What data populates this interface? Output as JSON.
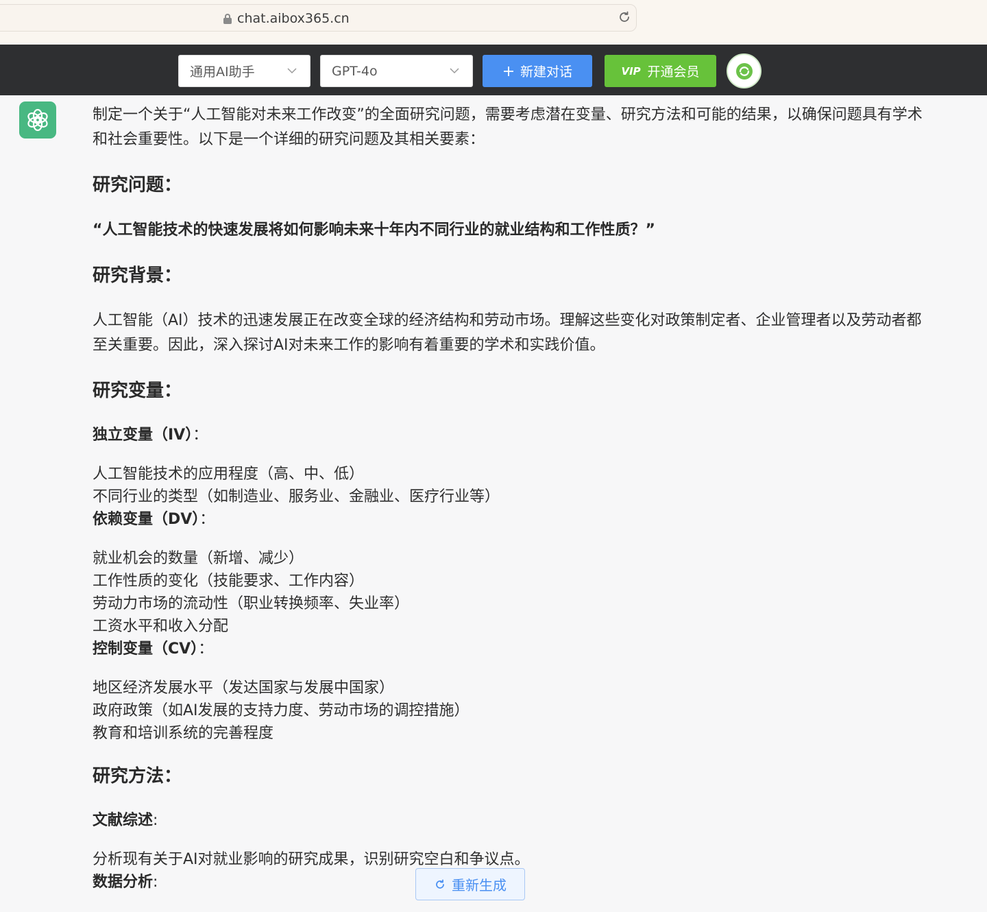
{
  "browser": {
    "url": "chat.aibox365.cn"
  },
  "toolbar": {
    "assistant_select": "通用AI助手",
    "model_select": "GPT-4o",
    "new_chat_label": "新建对话",
    "vip_label": "开通会员",
    "vip_badge_text": "VIP"
  },
  "message": {
    "intro": "制定一个关于“人工智能对未来工作改变”的全面研究问题，需要考虑潜在变量、研究方法和可能的结果，以确保问题具有学术和社会重要性。以下是一个详细的研究问题及其相关要素：",
    "question_heading": "研究问题：",
    "question_text": "“人工智能技术的快速发展将如何影响未来十年内不同行业的就业结构和工作性质？”",
    "background_heading": "研究背景：",
    "background_text": "人工智能（AI）技术的迅速发展正在改变全球的经济结构和劳动市场。理解这些变化对政策制定者、企业管理者以及劳动者都至关重要。因此，深入探讨AI对未来工作的影响有着重要的学术和实践价值。",
    "variables_heading": "研究变量：",
    "iv_label": "独立变量（IV）",
    "iv_items": [
      "人工智能技术的应用程度（高、中、低）",
      "不同行业的类型（如制造业、服务业、金融业、医疗行业等）"
    ],
    "dv_label": "依赖变量（DV）",
    "dv_items": [
      "就业机会的数量（新增、减少）",
      "工作性质的变化（技能要求、工作内容）",
      "劳动力市场的流动性（职业转换频率、失业率）",
      "工资水平和收入分配"
    ],
    "cv_label": "控制变量（CV）",
    "cv_items": [
      "地区经济发展水平（发达国家与发展中国家）",
      "政府政策（如AI发展的支持力度、劳动市场的调控措施）",
      "教育和培训系统的完善程度"
    ],
    "methods_heading": "研究方法：",
    "lit_label": "文献综述",
    "lit_text": "分析现有关于AI对就业影响的研究成果，识别研究空白和争议点。",
    "data_label": "数据分析",
    "colon": "：",
    "colon_short": ":"
  },
  "regen": {
    "label": "重新生成"
  },
  "colors": {
    "toolbar_bg": "#2e2f31",
    "new_chat": "#4a90f2",
    "vip": "#67c23a",
    "avatar": "#48b882"
  },
  "icons": [
    "lock-icon",
    "reload-icon",
    "chevron-down-icon",
    "plus-icon",
    "vip-icon",
    "refresh-icon",
    "chatgpt-logo-icon"
  ]
}
